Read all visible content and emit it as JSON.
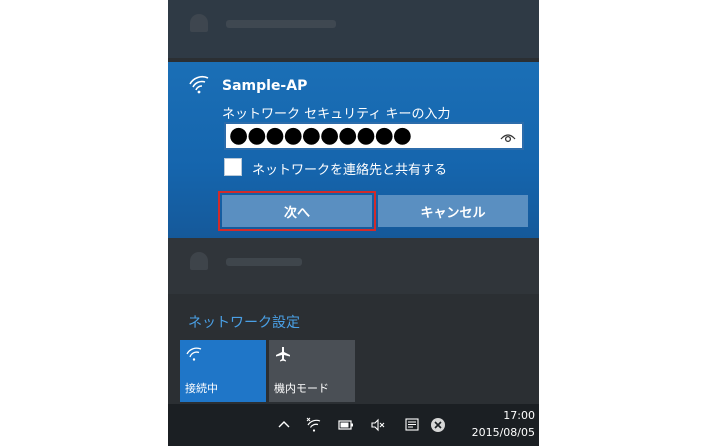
{
  "network": {
    "ssid": "Sample-AP",
    "key_label": "ネットワーク セキュリティ キーの入力",
    "password_masked": "●●●●●●●●●●",
    "share_label": "ネットワークを連絡先と共有する",
    "next_label": "次へ",
    "cancel_label": "キャンセル"
  },
  "settings_link": "ネットワーク設定",
  "quick_actions": [
    {
      "label": "接続中",
      "icon": "wifi-icon"
    },
    {
      "label": "機内モード",
      "icon": "airplane-icon"
    }
  ],
  "taskbar": {
    "time": "17:00",
    "date": "2015/08/05",
    "icons": [
      "chevron-up-icon",
      "wifi-icon",
      "battery-icon",
      "volume-mute-icon",
      "action-center-icon",
      "close-icon"
    ]
  },
  "colors": {
    "accent": "#1b6fb6",
    "highlight": "#d12b2b",
    "link": "#4aa0e6"
  }
}
